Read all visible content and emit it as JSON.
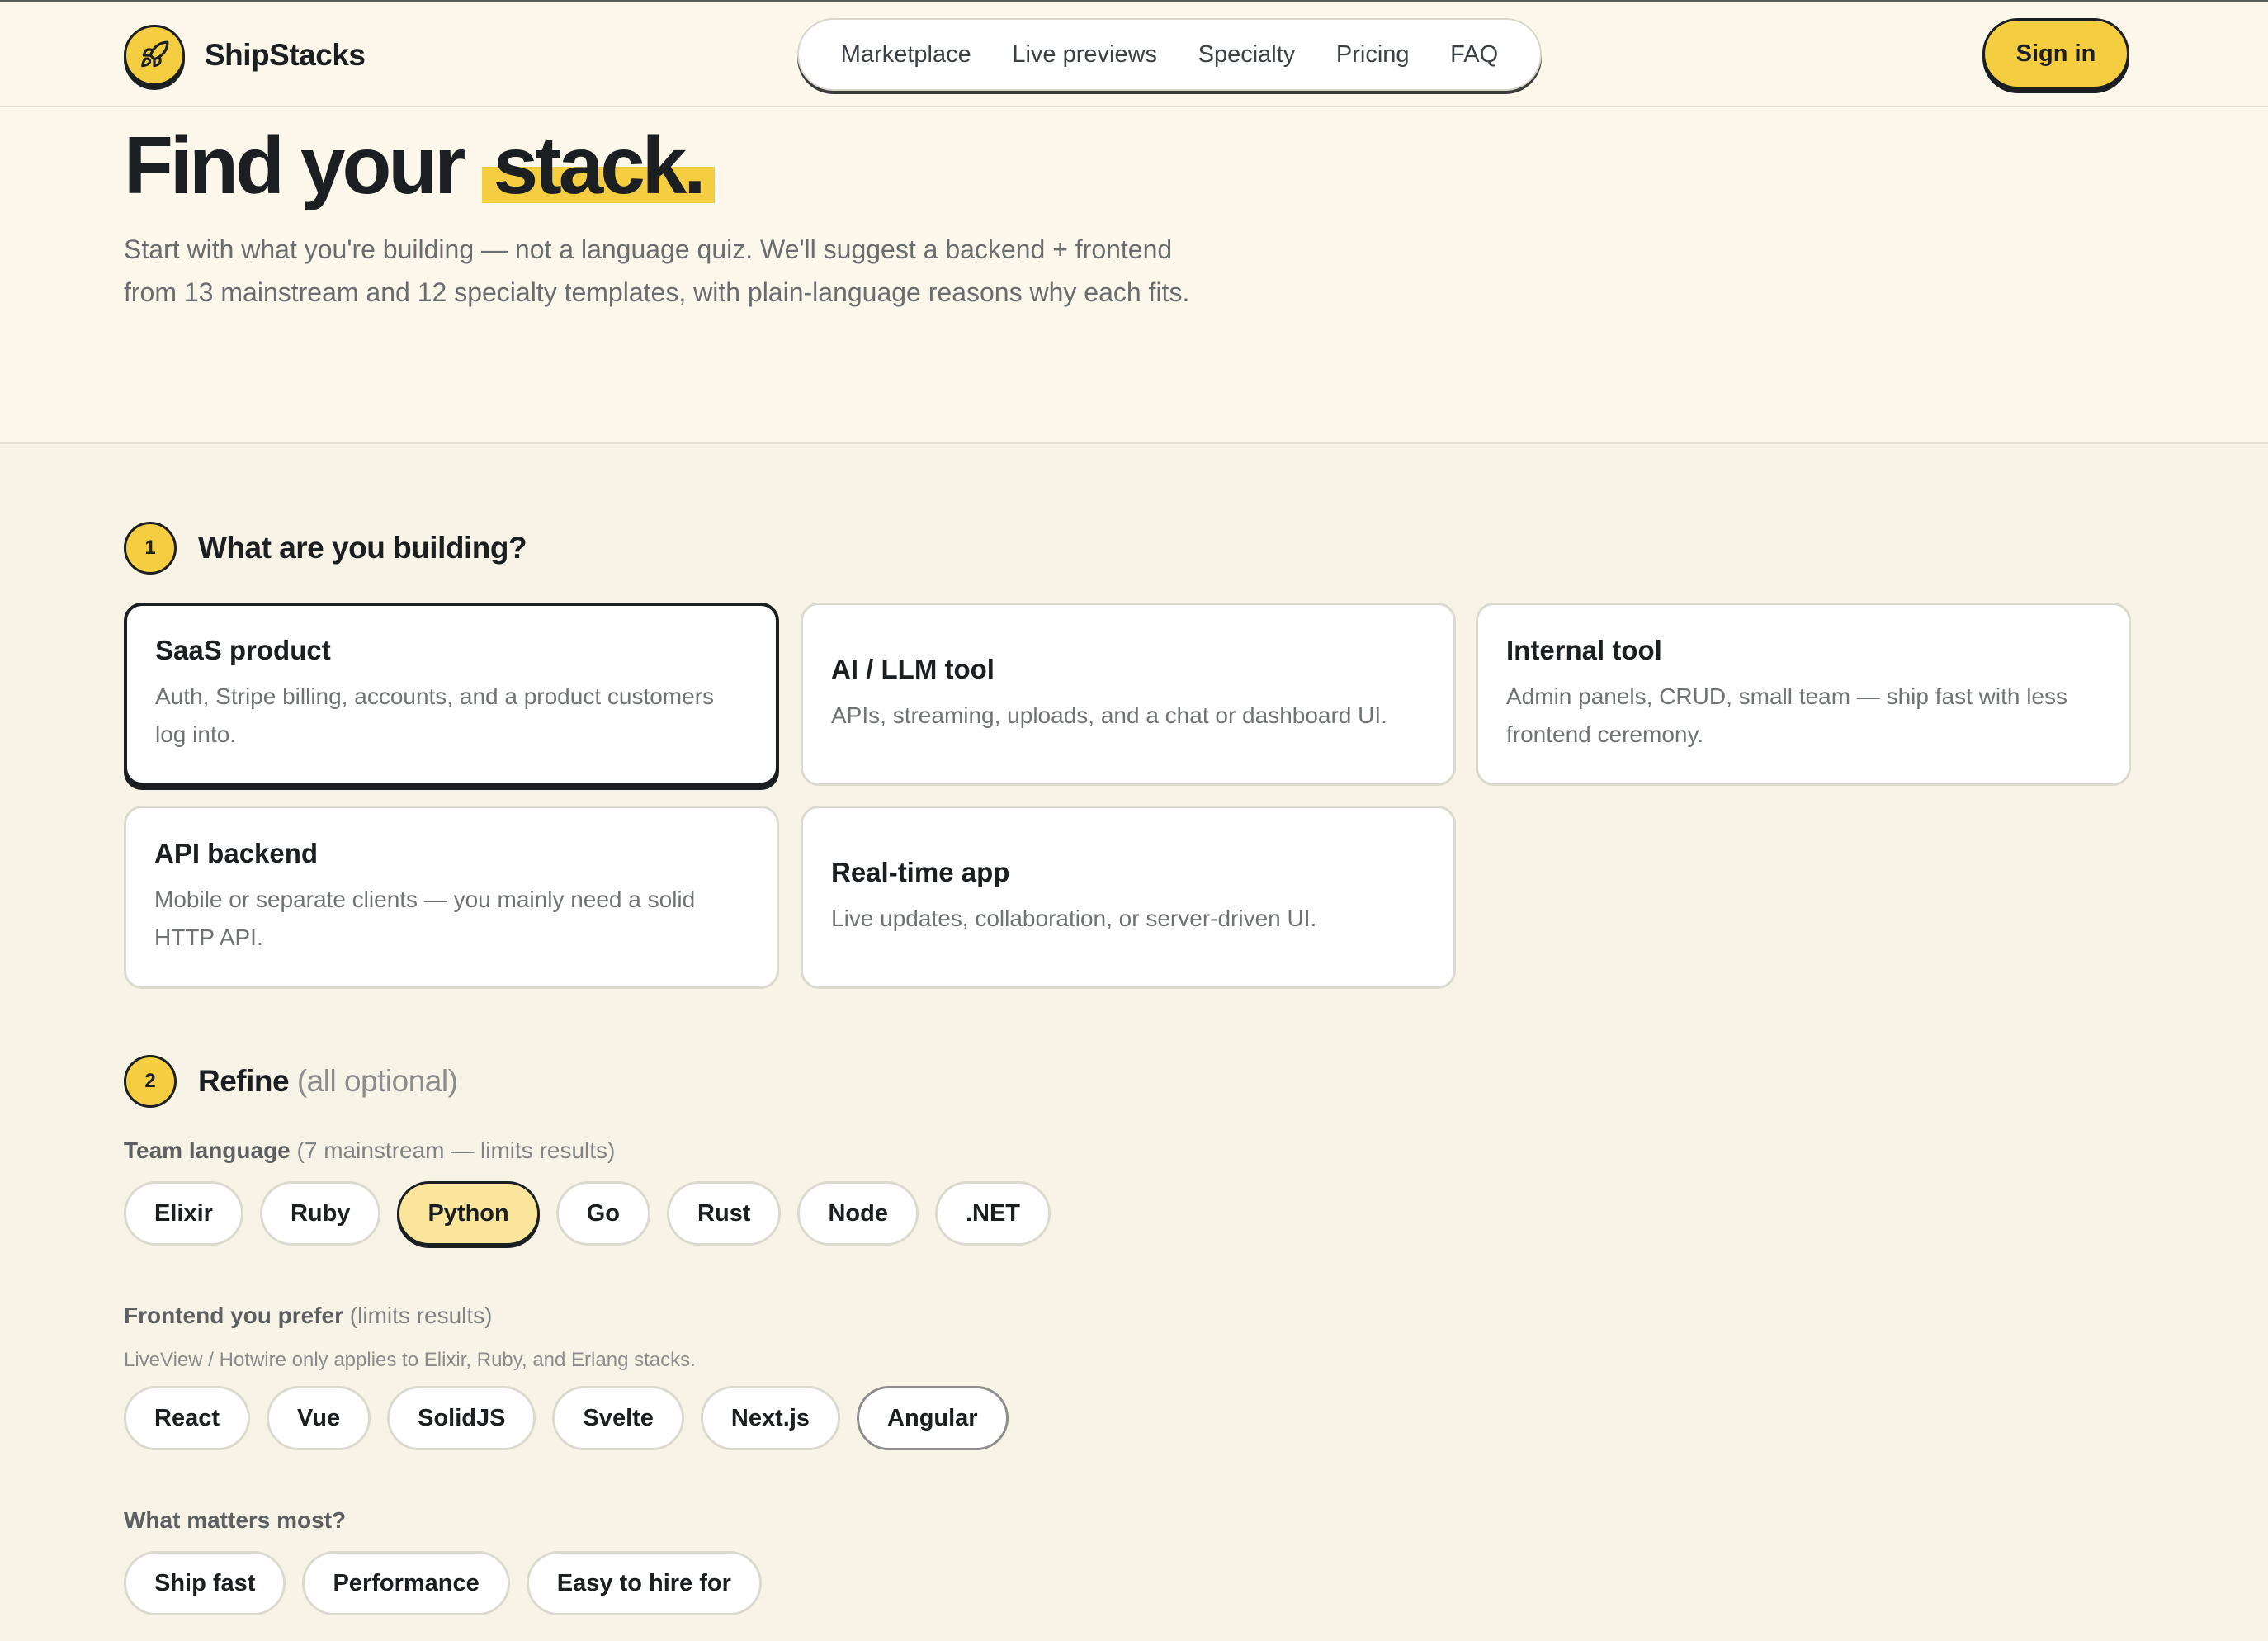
{
  "brand": {
    "name": "ShipStacks",
    "icon": "rocket-icon"
  },
  "nav": {
    "items": [
      "Marketplace",
      "Live previews",
      "Specialty",
      "Pricing",
      "FAQ"
    ],
    "signin": "Sign in"
  },
  "hero": {
    "title_main": "Find your",
    "title_highlight": "stack.",
    "subtitle_line1": "Start with what you're building — not a language quiz. We'll suggest a backend + frontend",
    "subtitle_line2": "from 13 mainstream and 12 specialty templates, with plain-language reasons why each fits."
  },
  "step1": {
    "number": "1",
    "title": "What are you building?",
    "cards": [
      {
        "title": "SaaS product",
        "desc": "Auth, Stripe billing, accounts, and a product customers log into.",
        "selected": true
      },
      {
        "title": "AI / LLM tool",
        "desc": "APIs, streaming, uploads, and a chat or dashboard UI.",
        "selected": false
      },
      {
        "title": "Internal tool",
        "desc": "Admin panels, CRUD, small team — ship fast with less frontend ceremony.",
        "selected": false
      },
      {
        "title": "API backend",
        "desc": "Mobile or separate clients — you mainly need a solid HTTP API.",
        "selected": false
      },
      {
        "title": "Real-time app",
        "desc": "Live updates, collaboration, or server-driven UI.",
        "selected": false
      }
    ]
  },
  "step2": {
    "number": "2",
    "title": "Refine",
    "title_muted": "(all optional)",
    "language": {
      "label": "Team language",
      "label_muted": "(7 mainstream — limits results)",
      "options": [
        "Elixir",
        "Ruby",
        "Python",
        "Go",
        "Rust",
        "Node",
        ".NET"
      ],
      "selected": "Python"
    },
    "frontend": {
      "label": "Frontend you prefer",
      "label_muted": "(limits results)",
      "note": "LiveView / Hotwire only applies to Elixir, Ruby, and Erlang stacks.",
      "options": [
        "React",
        "Vue",
        "SolidJS",
        "Svelte",
        "Next.js",
        "Angular"
      ],
      "hovered": "Angular"
    },
    "priority": {
      "label": "What matters most?",
      "options": [
        "Ship fast",
        "Performance",
        "Easy to hire for"
      ]
    }
  }
}
